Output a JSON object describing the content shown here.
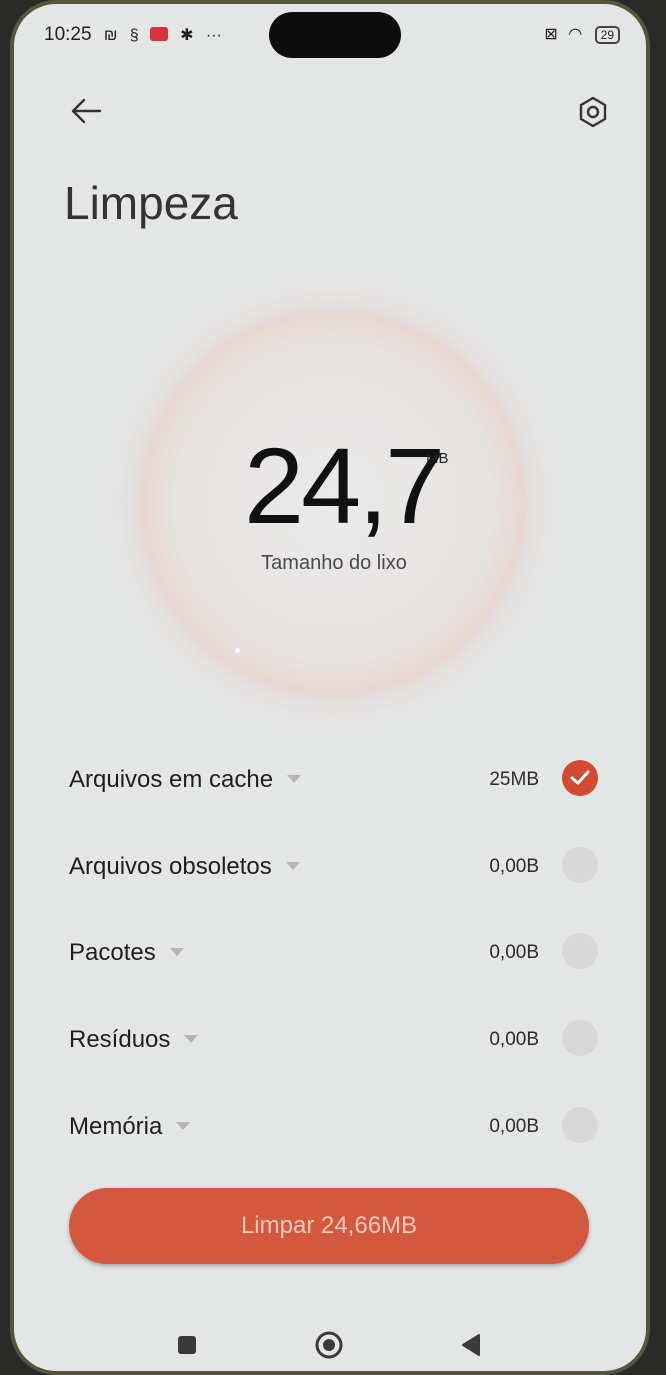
{
  "status_bar": {
    "time": "10:25",
    "battery": "29"
  },
  "header": {
    "back_icon": "arrow-left-icon",
    "settings_icon": "hexagon-settings-icon",
    "title": "Limpeza"
  },
  "gauge": {
    "value": "24,7",
    "unit": "MB",
    "label": "Tamanho do lixo"
  },
  "items": [
    {
      "label": "Arquivos em cache",
      "size": "25MB",
      "checked": true
    },
    {
      "label": "Arquivos obsoletos",
      "size": "0,00B",
      "checked": false
    },
    {
      "label": "Pacotes",
      "size": "0,00B",
      "checked": false
    },
    {
      "label": "Resíduos",
      "size": "0,00B",
      "checked": false
    },
    {
      "label": "Memória",
      "size": "0,00B",
      "checked": false
    }
  ],
  "action": {
    "clean_label": "Limpar 24,66MB"
  },
  "nav": {
    "recents_icon": "square-recents-icon",
    "home_icon": "circle-home-icon",
    "back_icon": "triangle-back-icon"
  },
  "colors": {
    "accent": "#d4583d",
    "check_on": "#d24a30",
    "background": "#e4e6e5"
  }
}
